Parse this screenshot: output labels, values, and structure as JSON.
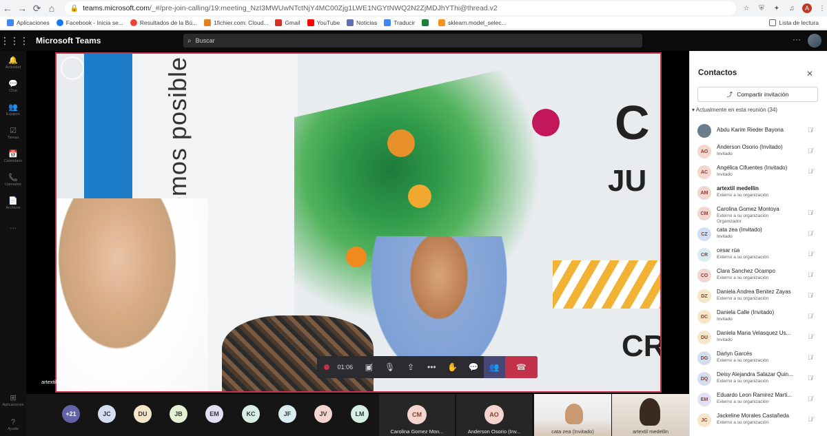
{
  "browser": {
    "url_host": "teams.microsoft.com",
    "url_path": "/_#/pre-join-calling/19:meeting_NzI3MWUwNTctNjY4MC00Zjg1LWE1NGYtNWQ2N2ZjMDJhYThi@thread.v2",
    "profile_initial": "A",
    "bookmarks": [
      "Aplicaciones",
      "Facebook - Inicia se...",
      "Resultados de la Bú...",
      "1fichier.com: Cloud...",
      "Gmail",
      "YouTube",
      "Noticias",
      "Traducir",
      "sklearn.model_selec..."
    ],
    "reading_list": "Lista de lectura"
  },
  "teams": {
    "title": "Microsoft Teams",
    "search_placeholder": "Buscar",
    "rail": [
      "Actividad",
      "Chat",
      "Equipos",
      "Tareas",
      "Calendario",
      "Llamadas",
      "Archivos",
      "...",
      "Aplicaciones",
      "Ayuda"
    ]
  },
  "call": {
    "speaker_label": "artextil medellin",
    "record_time": "01:06",
    "slogan": "JUNTOS lo hacemos posible",
    "strip_avatars": [
      "+21",
      "JC",
      "DU",
      "JB",
      "EM",
      "KC",
      "JF",
      "JV",
      "LM"
    ],
    "tiles": [
      {
        "initials": "CM",
        "label": "Carolina Gomez Mon..."
      },
      {
        "initials": "AO",
        "label": "Anderson Osorio (Inv..."
      }
    ],
    "video_thumbs": [
      "cata zea (Invitado)",
      "artextil medellin"
    ]
  },
  "contacts": {
    "title": "Contactos",
    "share_label": "Compartir invitación",
    "section_label": "Actualmente en esta reunión (34)",
    "participants": [
      {
        "initials": "",
        "name": "Abdu Karim Rieder Bayona",
        "sub": "",
        "sub2": "",
        "color": "#6b7c8c"
      },
      {
        "initials": "AO",
        "name": "Anderson Osorio (Invitado)",
        "sub": "Invitado",
        "sub2": "",
        "color": "#f3d6d0"
      },
      {
        "initials": "AC",
        "name": "Angélica Cifuentes (Invitado)",
        "sub": "Invitado",
        "sub2": "",
        "color": "#f3d6d0"
      },
      {
        "initials": "AM",
        "name": "artextil medellin",
        "sub": "Externo a su organización",
        "sub2": "",
        "color": "#f3d6d0"
      },
      {
        "initials": "CM",
        "name": "Carolina Gomez Montoya",
        "sub": "Externo a su organización",
        "sub2": "Organizador",
        "color": "#f3d6d0"
      },
      {
        "initials": "CZ",
        "name": "cata zea (Invitado)",
        "sub": "Invitado",
        "sub2": "",
        "color": "#d5def0"
      },
      {
        "initials": "CR",
        "name": "cesar rúa",
        "sub": "Externo a su organización",
        "sub2": "",
        "color": "#d9ecef"
      },
      {
        "initials": "CO",
        "name": "Clara Sanchez Ocampo",
        "sub": "Externo a su organización",
        "sub2": "",
        "color": "#f3d6d0"
      },
      {
        "initials": "DZ",
        "name": "Daniela Andrea Benitez Zayas",
        "sub": "Externo a su organización",
        "sub2": "",
        "color": "#f6e6c8"
      },
      {
        "initials": "DC",
        "name": "Daniela Calle (Invitado)",
        "sub": "Invitado",
        "sub2": "",
        "color": "#f6e6c8"
      },
      {
        "initials": "DU",
        "name": "Daniela Maria Velasquez Us...",
        "sub": "Invitado",
        "sub2": "",
        "color": "#f6e6c8"
      },
      {
        "initials": "DG",
        "name": "Darlyn Garcés",
        "sub": "Externo a su organización",
        "sub2": "",
        "color": "#d5def0"
      },
      {
        "initials": "DQ",
        "name": "Deisy Alejandra Salazar Quin...",
        "sub": "Externo a su organización",
        "sub2": "",
        "color": "#d5def0"
      },
      {
        "initials": "EM",
        "name": "Eduardo Leon Ramirez Marti...",
        "sub": "Externo a su organización",
        "sub2": "",
        "color": "#e4dff2"
      },
      {
        "initials": "JC",
        "name": "Jackeline Morales Castañeda",
        "sub": "Externo a su organización",
        "sub2": "",
        "color": "#f6e6c8"
      }
    ]
  }
}
